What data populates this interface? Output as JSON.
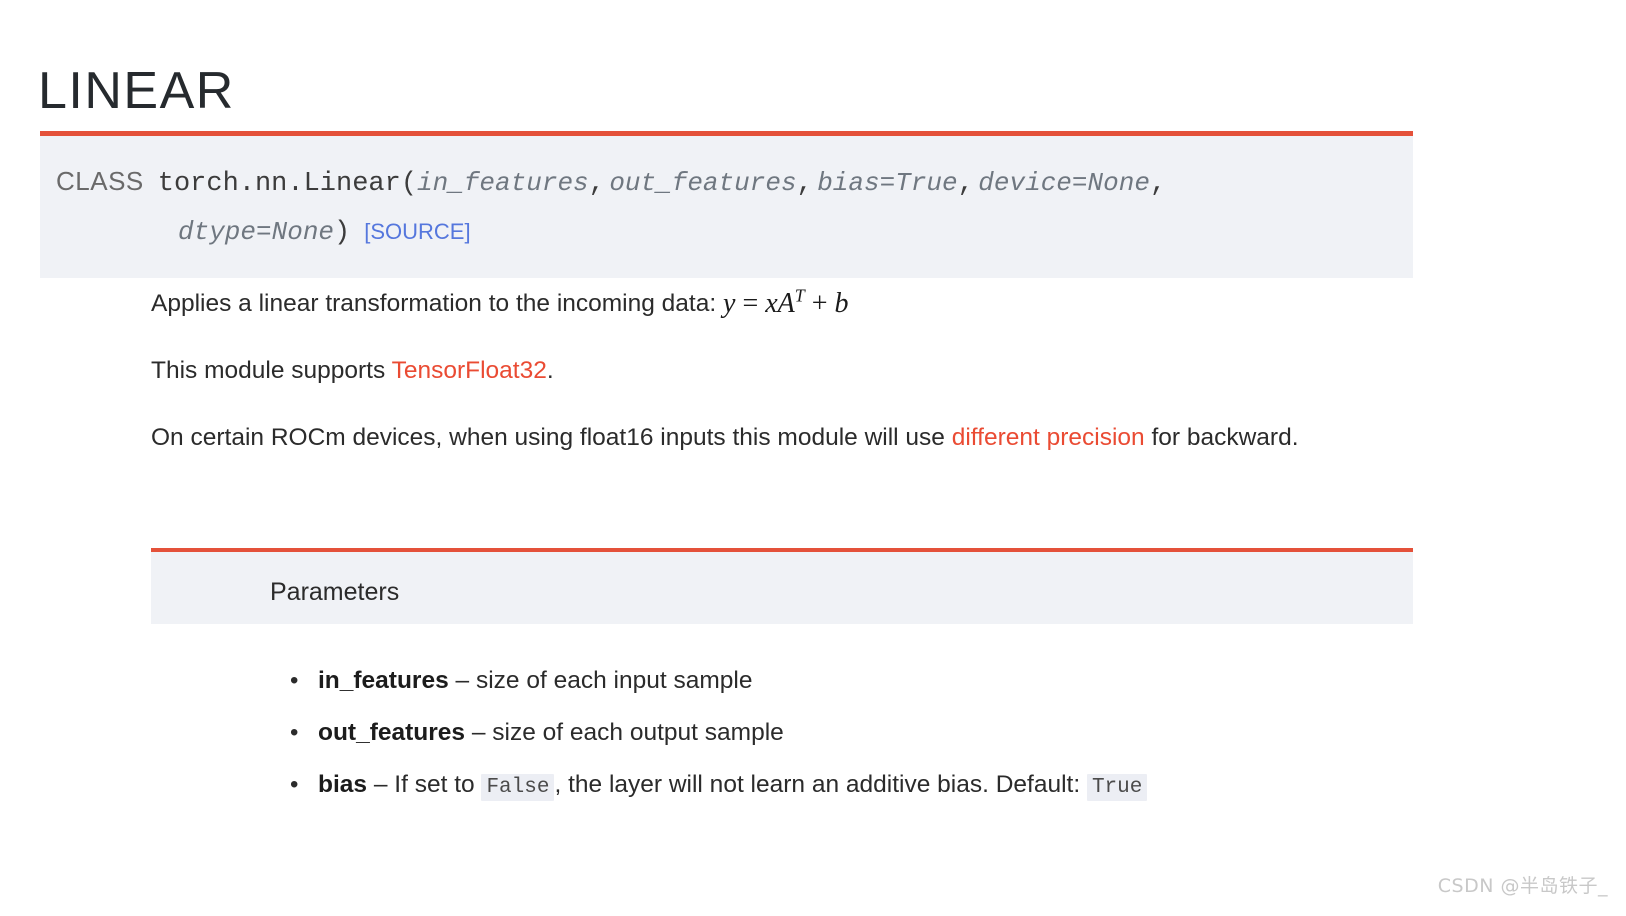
{
  "page": {
    "title": "LINEAR",
    "background": "#ffffff",
    "accent_red": "#e4513a",
    "link_red": "#ea4b33",
    "link_blue": "#5577dd",
    "block_bg": "#f0f2f6"
  },
  "signature": {
    "keyword": "CLASS",
    "qualified_name": "torch.nn.Linear",
    "open_paren": "(",
    "close_paren": ")",
    "comma": ",",
    "params_line1": [
      "in_features",
      "out_features",
      "bias=True",
      "device=None"
    ],
    "params_line2": [
      "dtype=None"
    ],
    "source_label": "[SOURCE]"
  },
  "body": {
    "paragraph1_prefix": "Applies a linear transformation to the incoming data:",
    "formula": {
      "lhs": "y",
      "equals": "=",
      "rhs_x": "x",
      "rhs_A": "A",
      "rhs_A_sup": "T",
      "plus": "+",
      "rhs_b": "b",
      "plain": "y = xA^T + b"
    },
    "paragraph2_prefix": "This module supports ",
    "paragraph2_link": "TensorFloat32",
    "paragraph2_suffix": ".",
    "paragraph3_prefix": "On certain ROCm devices, when using float16 inputs this module will use ",
    "paragraph3_link": "different precision",
    "paragraph3_suffix": " for backward."
  },
  "parameters": {
    "heading": "Parameters",
    "items": [
      {
        "name": "in_features",
        "dash": "–",
        "desc_before": " size of each input sample",
        "code1": "",
        "desc_mid": "",
        "code2": "",
        "desc_after": ""
      },
      {
        "name": "out_features",
        "dash": "–",
        "desc_before": " size of each output sample",
        "code1": "",
        "desc_mid": "",
        "code2": "",
        "desc_after": ""
      },
      {
        "name": "bias",
        "dash": "–",
        "desc_before": " If set to ",
        "code1": "False",
        "desc_mid": ", the layer will not learn an additive bias. Default: ",
        "code2": "True",
        "desc_after": ""
      }
    ]
  },
  "watermark": {
    "text": "CSDN @半岛铁子_"
  }
}
